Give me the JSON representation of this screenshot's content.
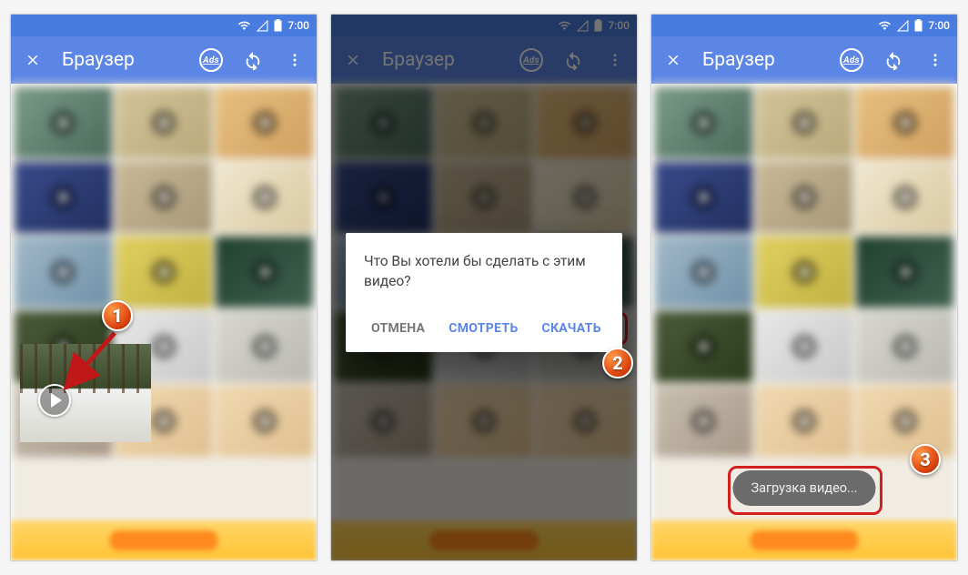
{
  "status": {
    "time": "7:00"
  },
  "appbar": {
    "title": "Браузер",
    "ads_label": "Ads"
  },
  "steps": {
    "s1": "1",
    "s2": "2",
    "s3": "3"
  },
  "dialog": {
    "message": "Что Вы хотели бы сделать с этим видео?",
    "cancel": "ОТМЕНА",
    "watch": "СМОТРЕТЬ",
    "download": "СКАЧАТЬ"
  },
  "toast": {
    "text": "Загрузка видео..."
  }
}
